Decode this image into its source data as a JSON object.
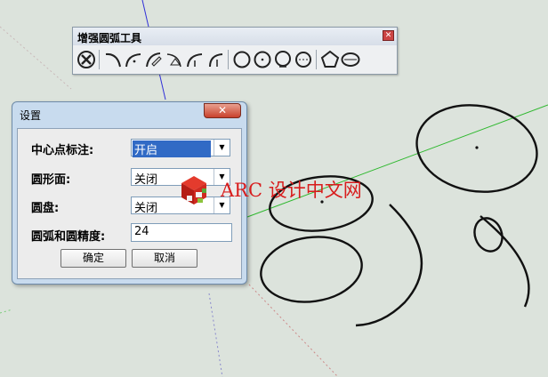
{
  "toolbar": {
    "title": "增强圆弧工具",
    "close_glyph": "✕",
    "icons": [
      "settings-icon",
      "arc-icon",
      "arc-tangent-icon",
      "arc-pencil-icon",
      "arc-angle-icon",
      "arc-fillet-icon",
      "arc-corner-icon",
      "circle-icon",
      "circle-inscribed-icon",
      "circle-3point-icon",
      "circle-tangent-icon",
      "polygon-icon",
      "ellipse-icon"
    ]
  },
  "dialog": {
    "title": "设置",
    "close_glyph": "✕",
    "fields": [
      {
        "label": "中心点标注:",
        "value": "开启"
      },
      {
        "label": "圆形面:",
        "value": "关闭"
      },
      {
        "label": "圆盘:",
        "value": "关闭"
      },
      {
        "label": "圆弧和圆精度:",
        "value": "24"
      }
    ],
    "ok_label": "确定",
    "cancel_label": "取消"
  },
  "watermark": {
    "text": "ARC 设计中文网"
  },
  "colors": {
    "background": "#dce3dc",
    "dialog_frame": "#c8dbee",
    "close_red": "#c8412c",
    "watermark_red": "#d81c1c",
    "axis_green": "#2eb82e",
    "axis_blue": "#2a2ad8"
  }
}
